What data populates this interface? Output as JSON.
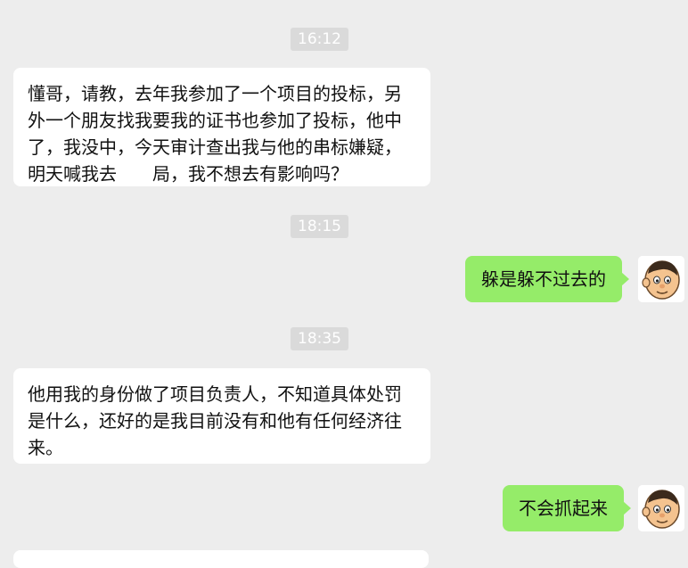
{
  "messages": [
    {
      "type": "timestamp",
      "text": "16:12"
    },
    {
      "type": "incoming",
      "text_before_redaction": "懂哥，请教，去年我参加了一个项目的投标，另外一个朋友找我要我的证书也参加了投标，他中了，我没中，今天审计查出我与他的串标嫌疑，明天喊我去",
      "text_after_redaction": "局，我不想去有影响吗？"
    },
    {
      "type": "timestamp",
      "text": "18:15"
    },
    {
      "type": "outgoing",
      "text": "躲是躲不过去的",
      "avatar_icon": "cartoon-boy-avatar"
    },
    {
      "type": "timestamp",
      "text": "18:35"
    },
    {
      "type": "incoming",
      "text": "他用我的身份做了项目负责人，不知道具体处罚是什么，还好的是我目前没有和他有任何经济往来。"
    },
    {
      "type": "outgoing",
      "text": "不会抓起来",
      "avatar_icon": "cartoon-boy-avatar"
    }
  ],
  "colors": {
    "background": "#ededed",
    "incoming_bubble": "#ffffff",
    "outgoing_bubble": "#95ec69",
    "timestamp_bg": "#dadada",
    "timestamp_text": "#ffffff",
    "message_text": "#111111"
  }
}
